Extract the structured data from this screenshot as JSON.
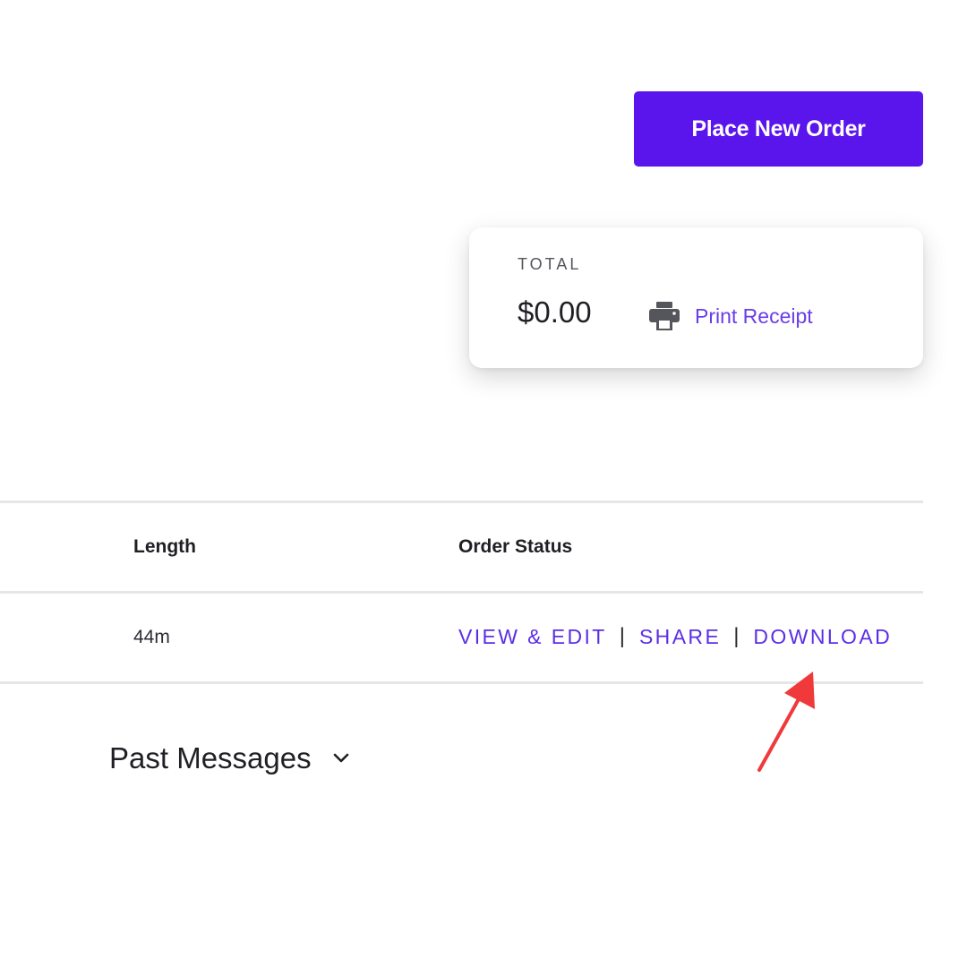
{
  "header": {
    "place_order_label": "Place New Order"
  },
  "total_card": {
    "label": "TOTAL",
    "value": "$0.00",
    "print_receipt_label": "Print Receipt",
    "print_icon": "printer-icon"
  },
  "table": {
    "headers": {
      "length": "Length",
      "order_status": "Order Status"
    },
    "rows": [
      {
        "length": "44m",
        "actions": {
          "view_edit": "VIEW & EDIT",
          "share": "SHARE",
          "download": "DOWNLOAD",
          "separator": "|"
        }
      }
    ]
  },
  "past_messages": {
    "label": "Past Messages",
    "icon": "chevron-down-icon"
  },
  "annotation": {
    "icon": "red-arrow-annotation",
    "color": "#f0393a"
  },
  "colors": {
    "primary": "#5a14ec",
    "link": "#5b2ee6",
    "divider": "#e6e6e9"
  }
}
